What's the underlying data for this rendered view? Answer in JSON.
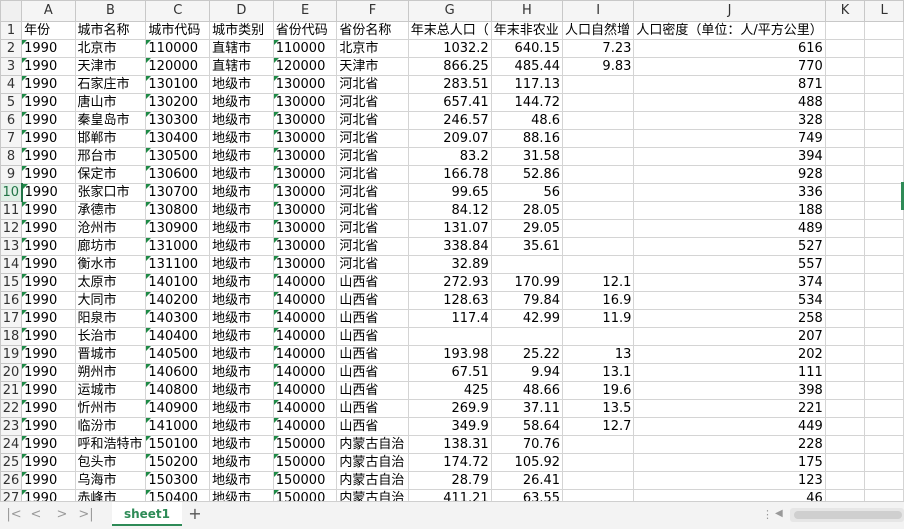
{
  "columns": [
    "A",
    "B",
    "C",
    "D",
    "E",
    "F",
    "G",
    "H",
    "I",
    "J",
    "K",
    "L"
  ],
  "rows": [
    {
      "n": "1",
      "cells": [
        "年份",
        "城市名称",
        "城市代码",
        "城市类别",
        "省份代码",
        "省份名称",
        "年末总人口（",
        "年末非农业",
        "人口自然增",
        "人口密度（单位：人/平方公里）",
        "",
        ""
      ]
    },
    {
      "n": "2",
      "cells": [
        "1990",
        "北京市",
        "110000",
        "直辖市",
        "110000",
        "北京市",
        "1032.2",
        "640.15",
        "7.23",
        "616",
        "",
        ""
      ]
    },
    {
      "n": "3",
      "cells": [
        "1990",
        "天津市",
        "120000",
        "直辖市",
        "120000",
        "天津市",
        "866.25",
        "485.44",
        "9.83",
        "770",
        "",
        ""
      ]
    },
    {
      "n": "4",
      "cells": [
        "1990",
        "石家庄市",
        "130100",
        "地级市",
        "130000",
        "河北省",
        "283.51",
        "117.13",
        "",
        "871",
        "",
        ""
      ]
    },
    {
      "n": "5",
      "cells": [
        "1990",
        "唐山市",
        "130200",
        "地级市",
        "130000",
        "河北省",
        "657.41",
        "144.72",
        "",
        "488",
        "",
        ""
      ]
    },
    {
      "n": "6",
      "cells": [
        "1990",
        "秦皇岛市",
        "130300",
        "地级市",
        "130000",
        "河北省",
        "246.57",
        "48.6",
        "",
        "328",
        "",
        ""
      ]
    },
    {
      "n": "7",
      "cells": [
        "1990",
        "邯郸市",
        "130400",
        "地级市",
        "130000",
        "河北省",
        "209.07",
        "88.16",
        "",
        "749",
        "",
        ""
      ]
    },
    {
      "n": "8",
      "cells": [
        "1990",
        "邢台市",
        "130500",
        "地级市",
        "130000",
        "河北省",
        "83.2",
        "31.58",
        "",
        "394",
        "",
        ""
      ]
    },
    {
      "n": "9",
      "cells": [
        "1990",
        "保定市",
        "130600",
        "地级市",
        "130000",
        "河北省",
        "166.78",
        "52.86",
        "",
        "928",
        "",
        ""
      ]
    },
    {
      "n": "10",
      "cells": [
        "1990",
        "张家口市",
        "130700",
        "地级市",
        "130000",
        "河北省",
        "99.65",
        "56",
        "",
        "336",
        "",
        ""
      ]
    },
    {
      "n": "11",
      "cells": [
        "1990",
        "承德市",
        "130800",
        "地级市",
        "130000",
        "河北省",
        "84.12",
        "28.05",
        "",
        "188",
        "",
        ""
      ]
    },
    {
      "n": "12",
      "cells": [
        "1990",
        "沧州市",
        "130900",
        "地级市",
        "130000",
        "河北省",
        "131.07",
        "29.05",
        "",
        "489",
        "",
        ""
      ]
    },
    {
      "n": "13",
      "cells": [
        "1990",
        "廊坊市",
        "131000",
        "地级市",
        "130000",
        "河北省",
        "338.84",
        "35.61",
        "",
        "527",
        "",
        ""
      ]
    },
    {
      "n": "14",
      "cells": [
        "1990",
        "衡水市",
        "131100",
        "地级市",
        "130000",
        "河北省",
        "32.89",
        "",
        "",
        "557",
        "",
        ""
      ]
    },
    {
      "n": "15",
      "cells": [
        "1990",
        "太原市",
        "140100",
        "地级市",
        "140000",
        "山西省",
        "272.93",
        "170.99",
        "12.1",
        "374",
        "",
        ""
      ]
    },
    {
      "n": "16",
      "cells": [
        "1990",
        "大同市",
        "140200",
        "地级市",
        "140000",
        "山西省",
        "128.63",
        "79.84",
        "16.9",
        "534",
        "",
        ""
      ]
    },
    {
      "n": "17",
      "cells": [
        "1990",
        "阳泉市",
        "140300",
        "地级市",
        "140000",
        "山西省",
        "117.4",
        "42.99",
        "11.9",
        "258",
        "",
        ""
      ]
    },
    {
      "n": "18",
      "cells": [
        "1990",
        "长治市",
        "140400",
        "地级市",
        "140000",
        "山西省",
        "",
        "",
        "",
        "207",
        "",
        ""
      ]
    },
    {
      "n": "19",
      "cells": [
        "1990",
        "晋城市",
        "140500",
        "地级市",
        "140000",
        "山西省",
        "193.98",
        "25.22",
        "13",
        "202",
        "",
        ""
      ]
    },
    {
      "n": "20",
      "cells": [
        "1990",
        "朔州市",
        "140600",
        "地级市",
        "140000",
        "山西省",
        "67.51",
        "9.94",
        "13.1",
        "111",
        "",
        ""
      ]
    },
    {
      "n": "21",
      "cells": [
        "1990",
        "运城市",
        "140800",
        "地级市",
        "140000",
        "山西省",
        "425",
        "48.66",
        "19.6",
        "398",
        "",
        ""
      ]
    },
    {
      "n": "22",
      "cells": [
        "1990",
        "忻州市",
        "140900",
        "地级市",
        "140000",
        "山西省",
        "269.9",
        "37.11",
        "13.5",
        "221",
        "",
        ""
      ]
    },
    {
      "n": "23",
      "cells": [
        "1990",
        "临汾市",
        "141000",
        "地级市",
        "140000",
        "山西省",
        "349.9",
        "58.64",
        "12.7",
        "449",
        "",
        ""
      ]
    },
    {
      "n": "24",
      "cells": [
        "1990",
        "呼和浩特市",
        "150100",
        "地级市",
        "150000",
        "内蒙古自治",
        "138.31",
        "70.76",
        "",
        "228",
        "",
        ""
      ]
    },
    {
      "n": "25",
      "cells": [
        "1990",
        "包头市",
        "150200",
        "地级市",
        "150000",
        "内蒙古自治",
        "174.72",
        "105.92",
        "",
        "175",
        "",
        ""
      ]
    },
    {
      "n": "26",
      "cells": [
        "1990",
        "乌海市",
        "150300",
        "地级市",
        "150000",
        "内蒙古自治",
        "28.79",
        "26.41",
        "",
        "123",
        "",
        ""
      ]
    },
    {
      "n": "27",
      "cells": [
        "1990",
        "赤峰市",
        "150400",
        "地级市",
        "150000",
        "内蒙古自治",
        "411.21",
        "63.55",
        "",
        "46",
        "",
        ""
      ]
    }
  ],
  "selected_row": "10",
  "sheet_tab": "sheet1",
  "nav": {
    "first": "|<",
    "prev": "<",
    "next": ">",
    "last": ">|"
  },
  "add_sheet": "+",
  "accent_color": "#2e8b57"
}
